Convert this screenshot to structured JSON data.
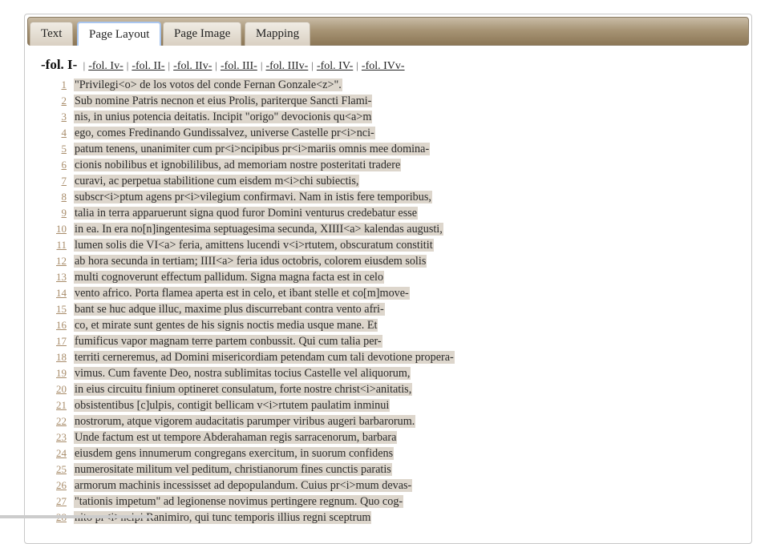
{
  "tabs": [
    {
      "label": "Text"
    },
    {
      "label": "Page Layout",
      "active": true
    },
    {
      "label": "Page Image"
    },
    {
      "label": "Mapping"
    }
  ],
  "folio_nav": {
    "current": "-fol. I-",
    "links": [
      "-fol. Iv-",
      "-fol. II-",
      "-fol. IIv-",
      "-fol. III-",
      "-fol. IIIv-",
      "-fol. IV-",
      "-fol. IVv-"
    ],
    "separator": "|"
  },
  "lines": [
    {
      "n": "1",
      "text": "\"Privilegi<o> de los votos del conde Fernan Gonzale<z>\"."
    },
    {
      "n": "2",
      "text": "Sub nomine Patris necnon et eius Prolis, pariterque Sancti Flami-"
    },
    {
      "n": "3",
      "text": "nis, in unius potencia deitatis. Incipit \"origo\" devocionis qu<a>m"
    },
    {
      "n": "4",
      "text": "ego, comes Fredinando Gundissalvez, universe Castelle pr<i>nci-"
    },
    {
      "n": "5",
      "text": "patum tenens, unanimiter cum pr<i>ncipibus pr<i>mariis omnis mee domina-"
    },
    {
      "n": "6",
      "text": "cionis nobilibus et ignobililibus, ad memoriam nostre posteritati tradere"
    },
    {
      "n": "7",
      "text": "curavi, ac perpetua stabilitione cum eisdem m<i>chi subiectis,"
    },
    {
      "n": "8",
      "text": "subscr<i>ptum agens pr<i>vilegium confirmavi. Nam in istis fere temporibus,"
    },
    {
      "n": "9",
      "text": "talia in terra apparuerunt signa quod furor Domini venturus credebatur esse"
    },
    {
      "n": "10",
      "text": "in ea. In era no[n]ingentesima septuagesima secunda, XIIII<a> kalendas augusti,"
    },
    {
      "n": "11",
      "text": "lumen solis die VI<a> feria, amittens lucendi v<i>rtutem, obscuratum constitit"
    },
    {
      "n": "12",
      "text": "ab hora secunda in tertiam; IIII<a> feria idus octobris, colorem eiusdem solis"
    },
    {
      "n": "13",
      "text": "multi cognoverunt effectum pallidum. Signa magna facta est in celo"
    },
    {
      "n": "14",
      "text": "vento africo. Porta flamea aperta est in celo, et ibant stelle et co[m]move-"
    },
    {
      "n": "15",
      "text": "bant se huc adque illuc, maxime plus discurrebant contra vento afri-"
    },
    {
      "n": "16",
      "text": "co, et mirate sunt gentes de his signis noctis media usque mane. Et"
    },
    {
      "n": "17",
      "text": "fumificus vapor magnam terre partem conbussit. Qui cum talia per-"
    },
    {
      "n": "18",
      "text": "territi cerneremus, ad Domini misericordiam petendam cum tali devotione propera-"
    },
    {
      "n": "19",
      "text": "vimus. Cum favente Deo, nostra sublimitas tocius Castelle vel aliquorum,"
    },
    {
      "n": "20",
      "text": "in eius circuitu finium optineret consulatum, forte nostre christ<i>anitatis,"
    },
    {
      "n": "21",
      "text": "obsistentibus [c]ulpis, contigit bellicam v<i>rtutem paulatim inminui"
    },
    {
      "n": "22",
      "text": "nostrorum, atque vigorem audacitatis parumper viribus augeri barbarorum."
    },
    {
      "n": "23",
      "text": "Unde factum est ut tempore Abderahaman regis sarracenorum, barbara"
    },
    {
      "n": "24",
      "text": "eiusdem gens innumerum congregans exercitum, in suorum confidens"
    },
    {
      "n": "25",
      "text": "numerositate militum vel peditum, christianorum fines cunctis paratis"
    },
    {
      "n": "26",
      "text": "armorum machinis incessisset ad depopulandum. Cuius pr<i>mum devas-"
    },
    {
      "n": "27",
      "text": "\"tationis impetum\" ad legionense novimus pertingere regnum. Quo cog-"
    },
    {
      "n": "28",
      "text": "nito pr<i>ncipi Ranimiro, qui tunc temporis illius regni sceptrum"
    }
  ]
}
